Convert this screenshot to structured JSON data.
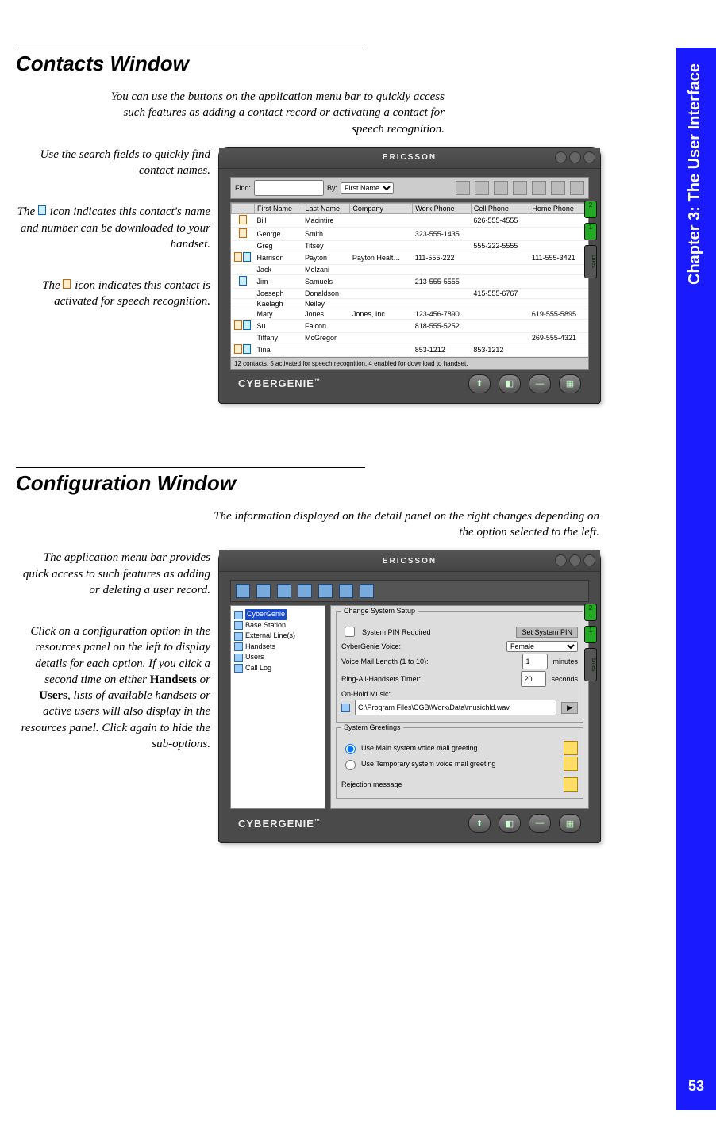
{
  "sidebar": {
    "chapter_label": "Chapter 3: The User Interface",
    "page_number": "53"
  },
  "section1": {
    "title": "Contacts Window",
    "top_callout": "You can use the buttons on the application menu bar to quickly access such features as adding a contact record or activating a contact for speech recognition.",
    "callouts": {
      "search": "Use the search fields to quickly find contact names.",
      "handset_a": "The ",
      "handset_b": " icon indicates this contact's name and number can be downloaded to your handset.",
      "speech_a": "The ",
      "speech_b": " icon indicates this contact is activated for speech recognition."
    },
    "window": {
      "brand": "ERICSSON",
      "find_label": "Find:",
      "by_label": "By:",
      "by_value": "First Name",
      "columns": [
        "First Name",
        "Last Name",
        "Company",
        "Work Phone",
        "Cell Phone",
        "Home Phone"
      ],
      "rows": [
        {
          "ic": "sp",
          "fn": "Bill",
          "ln": "Macintire",
          "co": "",
          "wp": "",
          "cp": "626-555-4555",
          "hp": ""
        },
        {
          "ic": "sp",
          "fn": "George",
          "ln": "Smith",
          "co": "",
          "wp": "323-555-1435",
          "cp": "",
          "hp": ""
        },
        {
          "ic": "",
          "fn": "Greg",
          "ln": "Titsey",
          "co": "",
          "wp": "",
          "cp": "555-222-5555",
          "hp": ""
        },
        {
          "ic": "sph",
          "fn": "Harrison",
          "ln": "Payton",
          "co": "Payton Healt…",
          "wp": "111-555-222",
          "cp": "",
          "hp": "111-555-3421"
        },
        {
          "ic": "",
          "fn": "Jack",
          "ln": "Molzani",
          "co": "",
          "wp": "",
          "cp": "",
          "hp": ""
        },
        {
          "ic": "h",
          "fn": "Jim",
          "ln": "Samuels",
          "co": "",
          "wp": "213-555-5555",
          "cp": "",
          "hp": ""
        },
        {
          "ic": "",
          "fn": "Joeseph",
          "ln": "Donaldson",
          "co": "",
          "wp": "",
          "cp": "415-555-6767",
          "hp": ""
        },
        {
          "ic": "",
          "fn": "Kaelagh",
          "ln": "Neiley",
          "co": "",
          "wp": "",
          "cp": "",
          "hp": ""
        },
        {
          "ic": "",
          "fn": "Mary",
          "ln": "Jones",
          "co": "Jones, Inc.",
          "wp": "123-456-7890",
          "cp": "",
          "hp": "619-555-5895"
        },
        {
          "ic": "sph",
          "fn": "Su",
          "ln": "Falcon",
          "co": "",
          "wp": "818-555-5252",
          "cp": "",
          "hp": ""
        },
        {
          "ic": "",
          "fn": "Tiffany",
          "ln": "McGregor",
          "co": "",
          "wp": "",
          "cp": "",
          "hp": "269-555-4321"
        },
        {
          "ic": "sph",
          "fn": "Tina",
          "ln": "",
          "co": "",
          "wp": "853-1212",
          "cp": "853-1212",
          "hp": ""
        }
      ],
      "status": "12 contacts. 5 activated for speech recognition. 4 enabled for download to handset.",
      "footer_logo": "CYBERGENIE"
    }
  },
  "section2": {
    "title": "Configuration Window",
    "top_callout": "The information displayed on the detail panel on the right changes depending on the option selected to the left.",
    "callouts": {
      "menubar": "The application menu bar provides quick access to such features as adding or deleting a user record.",
      "resources_a": "Click on a configuration option in the resources panel on the left to display details for each option. If you click a second time on either ",
      "resources_hs": "Handsets",
      "resources_mid": " or ",
      "resources_us": "Users",
      "resources_b": ", lists of available handsets or active users will also display in the resources panel. Click again to hide the sub-options."
    },
    "window": {
      "brand": "ERICSSON",
      "tree": [
        "CyberGenie",
        "Base Station",
        "External Line(s)",
        "Handsets",
        "Users",
        "Call Log"
      ],
      "group1_title": "Change System Setup",
      "pin_label": "System PIN Required",
      "pin_button": "Set System PIN",
      "voice_label": "CyberGenie Voice:",
      "voice_value": "Female",
      "vml_label": "Voice Mail Length (1 to 10):",
      "vml_value": "1",
      "vml_unit": "minutes",
      "ring_label": "Ring-All-Handsets Timer:",
      "ring_value": "20",
      "ring_unit": "seconds",
      "hold_label": "On-Hold Music:",
      "hold_path": "C:\\Program Files\\CGB\\Work\\Data\\musichld.wav",
      "group2_title": "System Greetings",
      "radio1": "Use Main system voice mail greeting",
      "radio2": "Use Temporary system voice mail greeting",
      "reject": "Rejection message",
      "footer_logo": "CYBERGENIE"
    }
  }
}
